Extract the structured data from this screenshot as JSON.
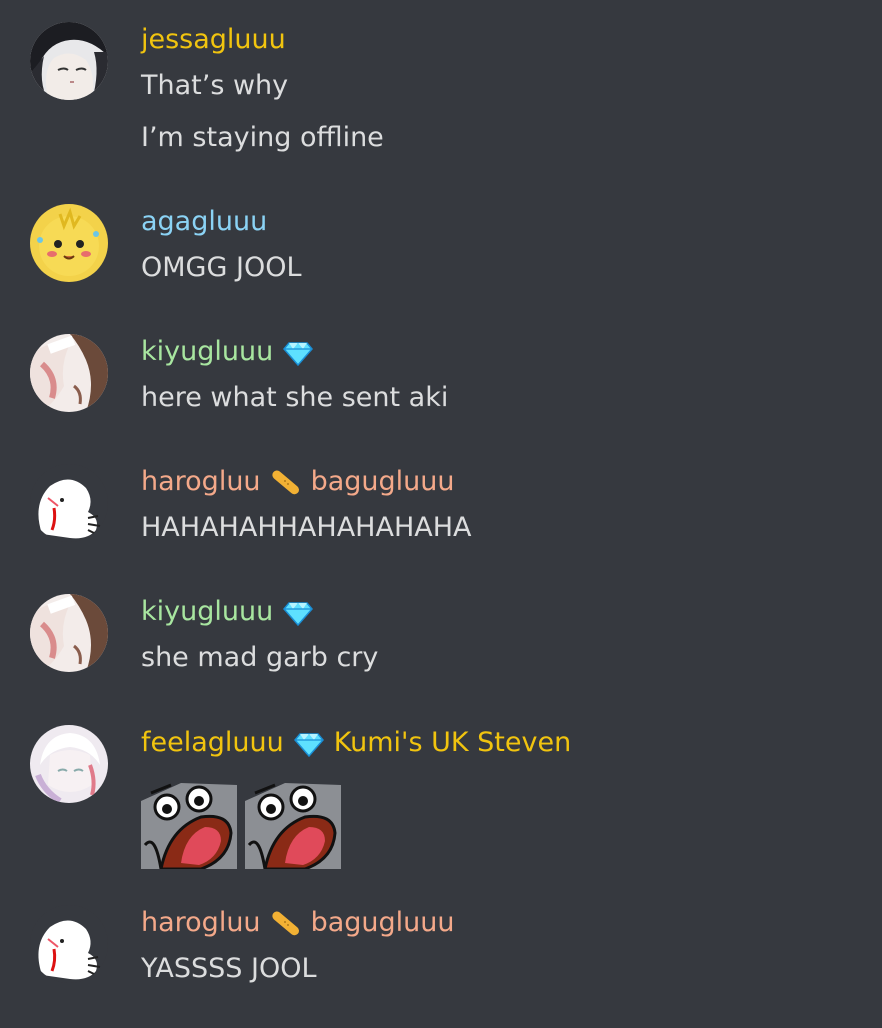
{
  "colors": {
    "background": "#36393f",
    "message_text": "#dcddde",
    "jessagluuu": "#f1c40f",
    "agagluuu": "#8bd3f5",
    "kiyugluuu": "#a8e6a0",
    "harogluu": "#f4a98a",
    "feelagluuu": "#f1c40f"
  },
  "messages": [
    {
      "avatar_icon": "anime-boy-avatar",
      "author": "jessagluuu",
      "lines": [
        "That’s why",
        "I’m staying offline"
      ]
    },
    {
      "avatar_icon": "yellow-chick-avatar",
      "author": "agagluuu",
      "lines": [
        "OMGG JOOL"
      ]
    },
    {
      "avatar_icon": "anime-girl-avatar",
      "author": "kiyugluuu",
      "badge_icon": "diamond-icon",
      "lines": [
        "here what she sent aki"
      ]
    },
    {
      "avatar_icon": "white-blob-avatar",
      "author": "harogluu",
      "badge_icon": "bandage-icon",
      "secondary_name": "bagugluuu",
      "lines": [
        "HAHAHAHHAHAHAHAHA"
      ]
    },
    {
      "avatar_icon": "anime-girl-avatar",
      "author": "kiyugluuu",
      "badge_icon": "diamond-icon",
      "lines": [
        "she mad garb cry"
      ]
    },
    {
      "avatar_icon": "white-hair-avatar",
      "author": "feelagluuu",
      "badge_icon": "diamond-icon",
      "secondary_name": "Kumi's UK Steven",
      "emotes": [
        "screaming-bird-emote",
        "screaming-bird-emote"
      ]
    },
    {
      "avatar_icon": "white-blob-avatar",
      "author": "harogluu",
      "badge_icon": "bandage-icon",
      "secondary_name": "bagugluuu",
      "lines": [
        "YASSSS JOOL"
      ]
    }
  ]
}
